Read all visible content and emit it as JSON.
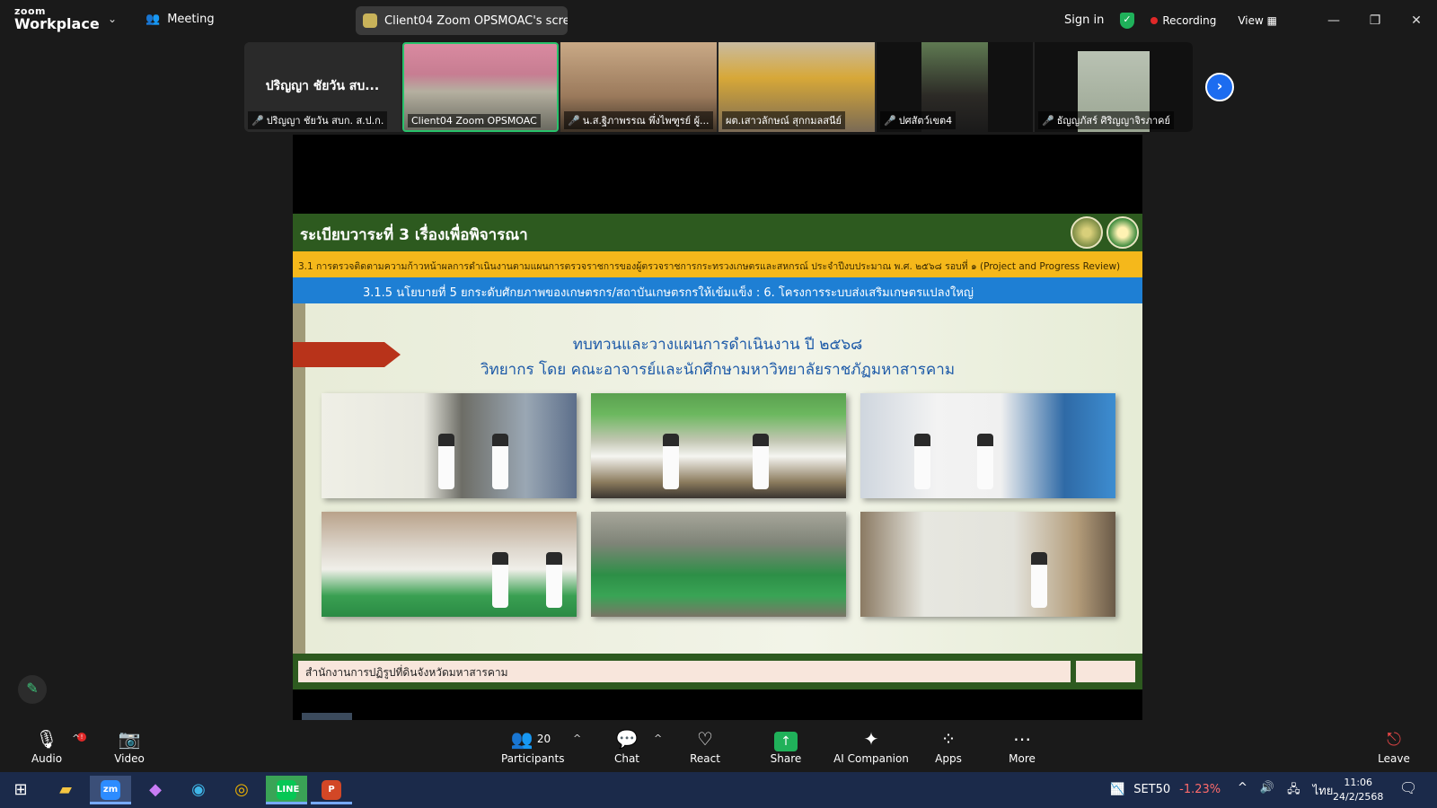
{
  "app": {
    "logo_top": "zoom",
    "logo_bottom": "Workplace",
    "meeting_label": "Meeting",
    "share_title": "Client04 Zoom OPSMOAC's scre",
    "sign_in": "Sign in",
    "recording": "Recording",
    "view": "View"
  },
  "participants": [
    {
      "big_name": "ปริญญา ชัยวัน สบ...",
      "label": "ปริญญา ชัยวัน สบก. ส.ป.ก."
    },
    {
      "label": "Client04 Zoom OPSMOAC"
    },
    {
      "label": "น.ส.ฐิภาพรรณ พึ่งไพฑูรย์ ผู้..."
    },
    {
      "label": "ผต.เสาวลักษณ์ สุกกมลสนีย์"
    },
    {
      "label": "ปศสัตว์เขต4"
    },
    {
      "label": "ธัญญภัสร์ ศิริญญาจิรภาคย์"
    }
  ],
  "slide": {
    "header": "ระเบียบวาระที่ 3 เรื่องเพื่อพิจารณา",
    "yellow_bar": "3.1 การตรวจติดตามความก้าวหน้าผลการดำเนินงานตามแผนการตรวจราชการของผู้ตรวจราชการกระทรวงเกษตรและสหกรณ์ ประจำปีงบประมาณ พ.ศ. ๒๕๖๘ รอบที่ ๑ (Project and Progress Review)",
    "blue_bar": "3.1.5 นโยบายที่ 5 ยกระดับศักยภาพของเกษตรกร/สถาบันเกษตรกรให้เข้มแข็ง : 6. โครงการระบบส่งเสริมเกษตรแปลงใหญ่",
    "line1": "ทบทวนและวางแผนการดำเนินงาน ปี ๒๕๖๘",
    "line2": "วิทยากร โดย คณะอาจารย์และนักศึกษามหาวิทยาลัยราชภัฏมหาสารคาม",
    "footer": "สำนักงานการปฏิรูปที่ดินจังหวัดมหาสารคาม"
  },
  "toolbar": {
    "audio": "Audio",
    "video": "Video",
    "participants": "Participants",
    "participants_count": "20",
    "chat": "Chat",
    "react": "React",
    "share": "Share",
    "ai": "AI Companion",
    "apps": "Apps",
    "more": "More",
    "leave": "Leave"
  },
  "taskbar": {
    "ticker_name": "SET50",
    "ticker_change": "-1.23%",
    "lang": "ไทย",
    "time": "11:06",
    "date": "24/2/2568"
  },
  "colors": {
    "zoom_blue": "#1c6cf0",
    "active_green": "#28c26b",
    "slide_green": "#2d5a1f",
    "slide_yellow": "#f5b81b",
    "slide_blue": "#1e7fd4"
  }
}
